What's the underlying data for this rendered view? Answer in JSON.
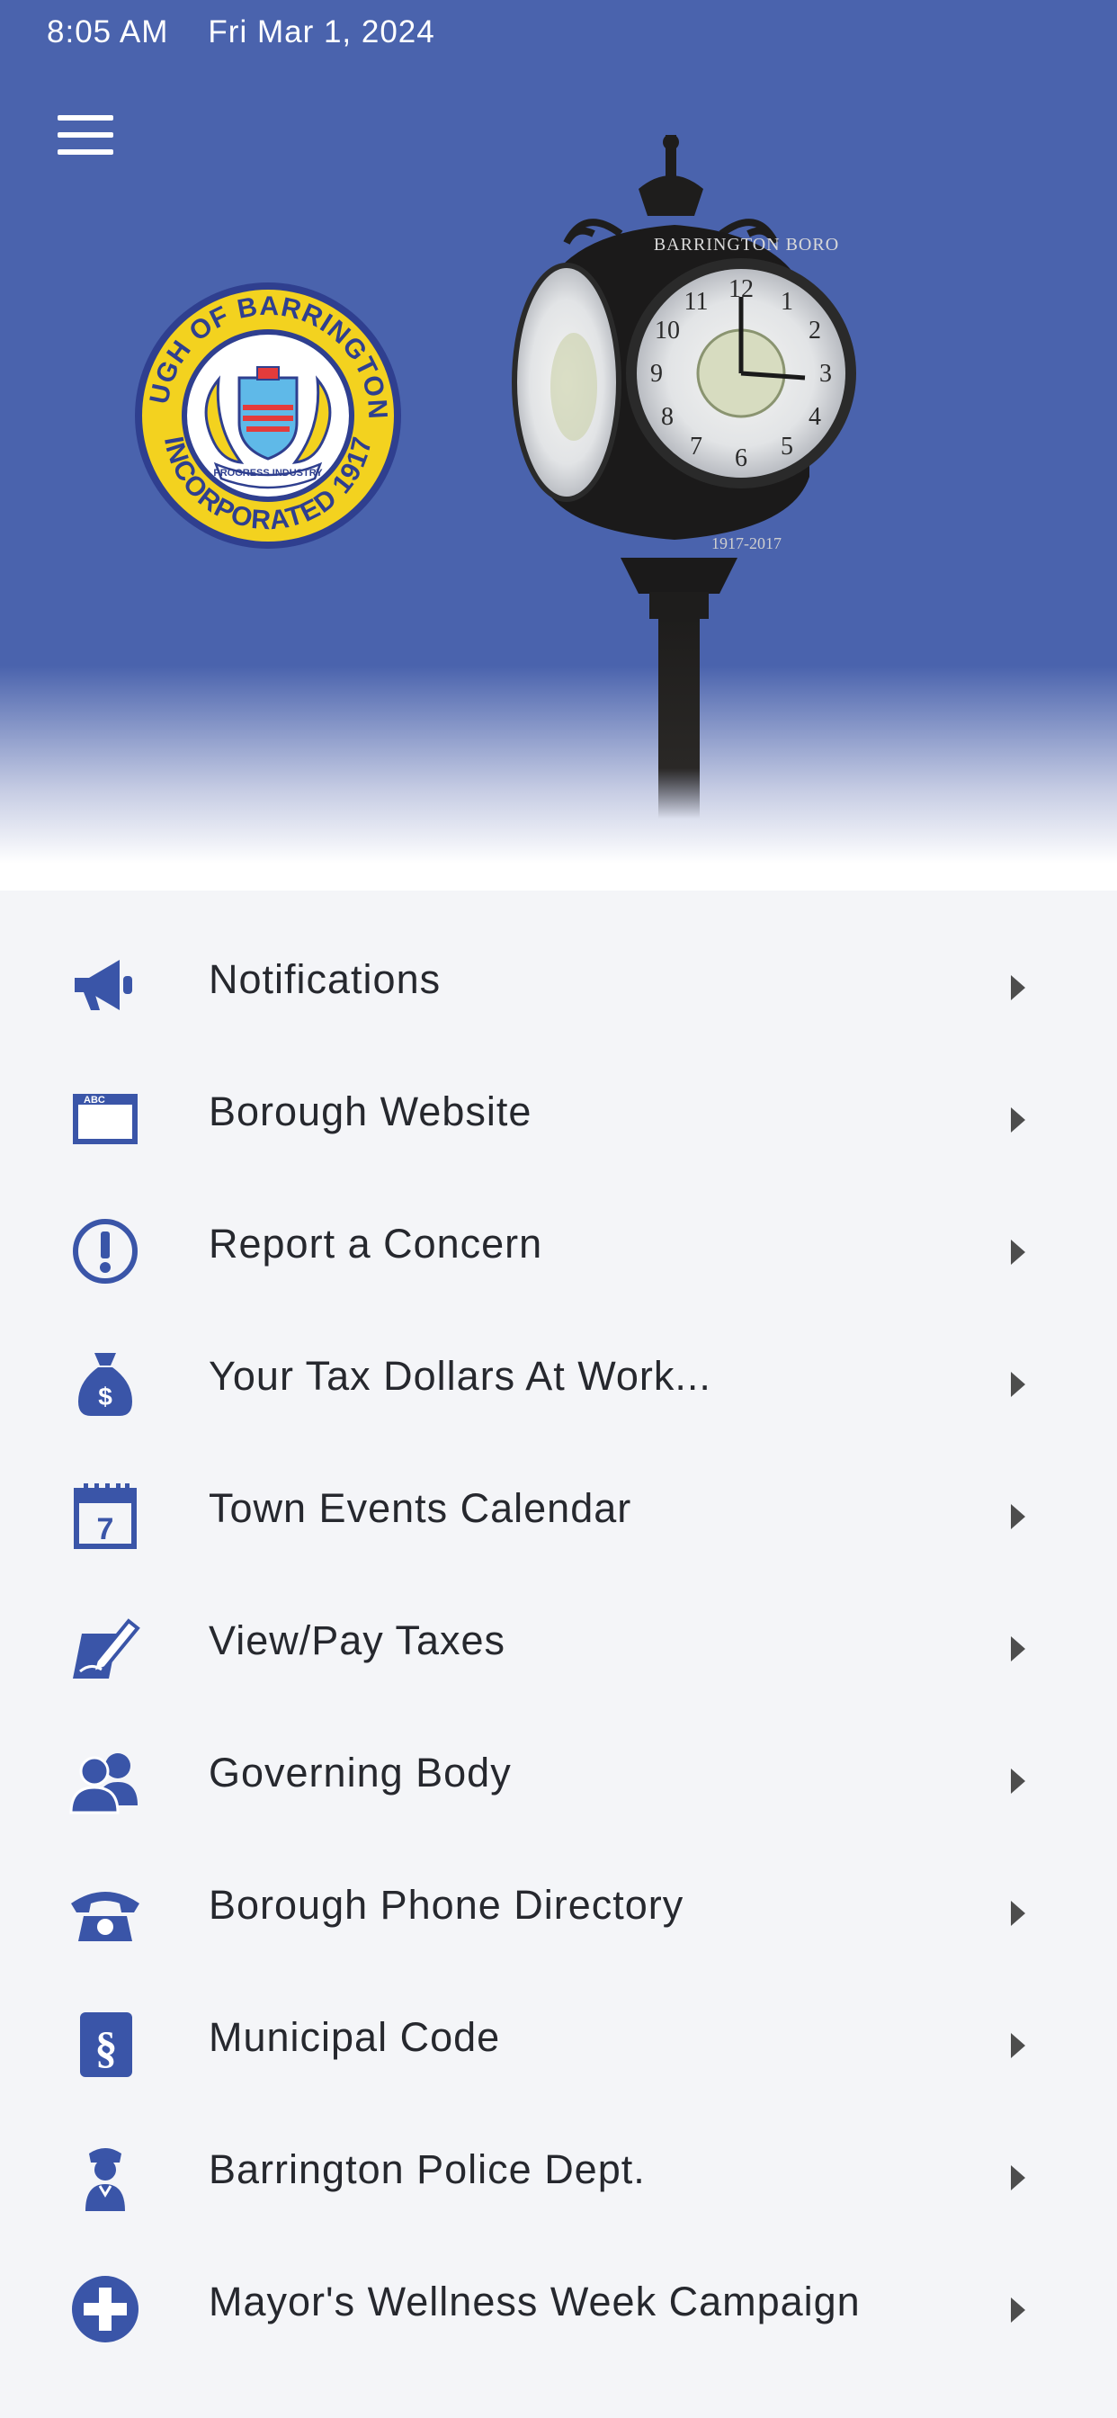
{
  "status_bar": {
    "time": "8:05 AM",
    "date": "Fri Mar 1, 2024"
  },
  "header": {
    "menu_icon": "hamburger-menu-icon",
    "seal": {
      "top_text": "BOROUGH OF BARRINGTON, N.J.",
      "bottom_text": "INCORPORATED 1917",
      "ribbon_text": "PROGRESS INDUSTRY"
    },
    "clock": {
      "brand_text": "BARRINGTON BORO",
      "years_text": "1917-2017"
    }
  },
  "colors": {
    "brand_blue": "#4a63ad",
    "icon_blue": "#3a55a8",
    "seal_yellow": "#f3d21f",
    "text": "#26282e"
  },
  "menu": {
    "items": [
      {
        "label": "Notifications",
        "icon": "megaphone-icon"
      },
      {
        "label": "Borough Website",
        "icon": "web-browser-icon"
      },
      {
        "label": "Report a Concern",
        "icon": "exclamation-circle-icon"
      },
      {
        "label": "Your Tax Dollars At Work...",
        "icon": "money-bag-icon"
      },
      {
        "label": "Town Events Calendar",
        "icon": "calendar-icon"
      },
      {
        "label": "View/Pay Taxes",
        "icon": "pen-document-icon"
      },
      {
        "label": "Governing Body",
        "icon": "people-icon"
      },
      {
        "label": "Borough Phone Directory",
        "icon": "telephone-icon"
      },
      {
        "label": "Municipal Code",
        "icon": "section-book-icon"
      },
      {
        "label": "Barrington Police Dept.",
        "icon": "police-officer-icon"
      },
      {
        "label": "Mayor's Wellness Week Campaign",
        "icon": "plus-circle-icon"
      }
    ]
  }
}
